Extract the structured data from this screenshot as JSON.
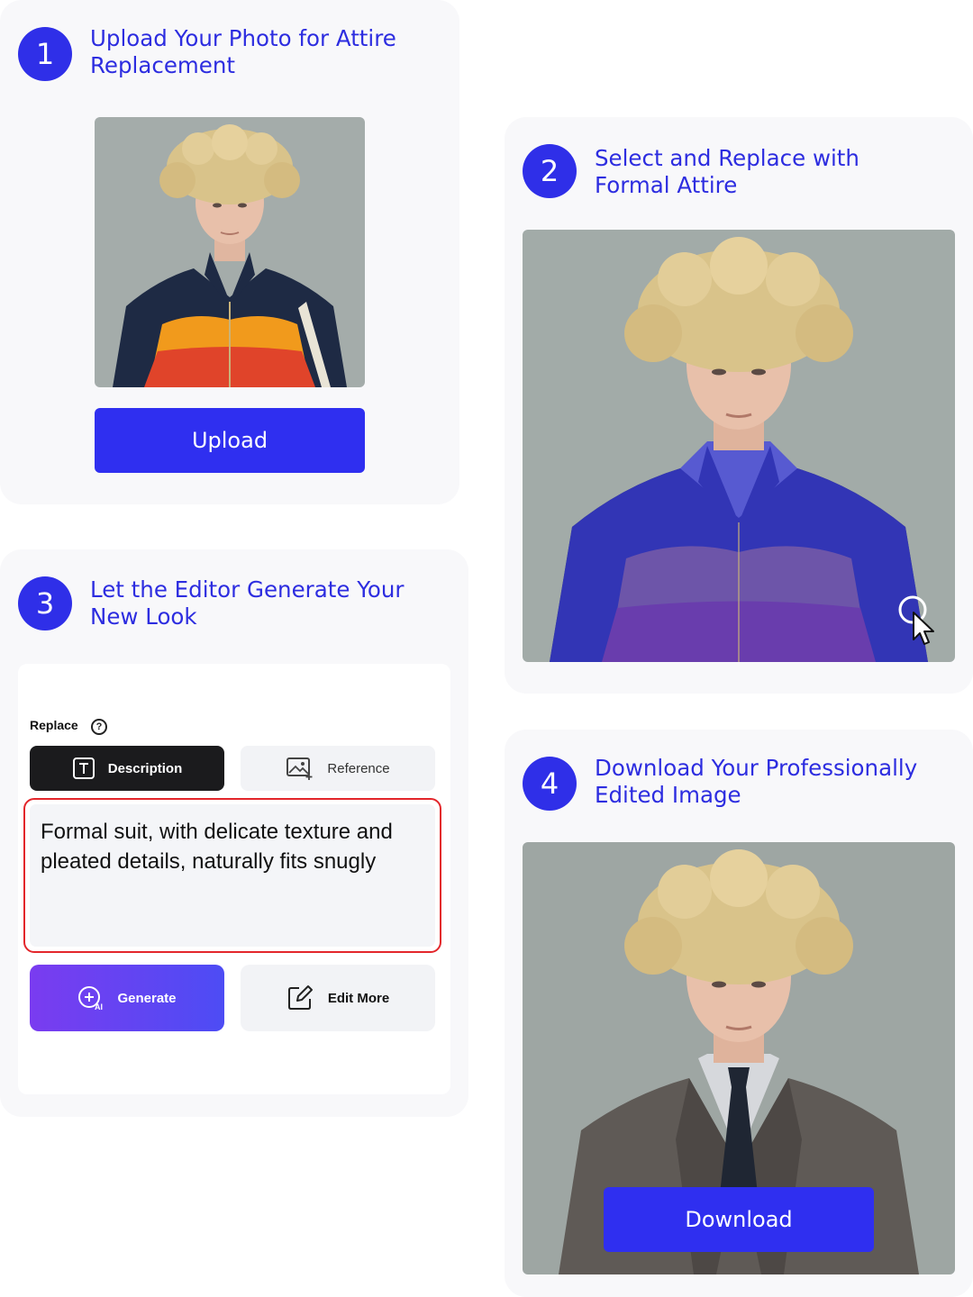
{
  "steps": [
    {
      "number": "1",
      "title": "Upload Your Photo for Attire Replacement"
    },
    {
      "number": "2",
      "title": "Select and Replace with Formal Attire"
    },
    {
      "number": "3",
      "title": "Let the Editor Generate Your New Look"
    },
    {
      "number": "4",
      "title": "Download Your Professionally Edited Image"
    }
  ],
  "step1": {
    "upload_label": "Upload"
  },
  "step3": {
    "replace_label": "Replace",
    "help_glyph": "?",
    "tabs": [
      {
        "label": "Description",
        "active": true
      },
      {
        "label": "Reference",
        "active": false
      }
    ],
    "description_text": "Formal suit, with delicate texture and pleated details, naturally fits snugly",
    "generate_label": "Generate",
    "edit_more_label": "Edit More"
  },
  "step4": {
    "download_label": "Download"
  },
  "colors": {
    "accent": "#2f2fe8",
    "title": "#2d2de0",
    "card_bg": "#f8f8fa",
    "highlight_border": "#e3262b",
    "mask_overlay": "#3a3ae0"
  },
  "icons": {
    "tab_description": "text-box-icon",
    "tab_reference": "image-add-icon",
    "generate": "ai-plus-icon",
    "edit_more": "edit-pencil-icon",
    "cursor": "pointer-cursor-icon"
  }
}
